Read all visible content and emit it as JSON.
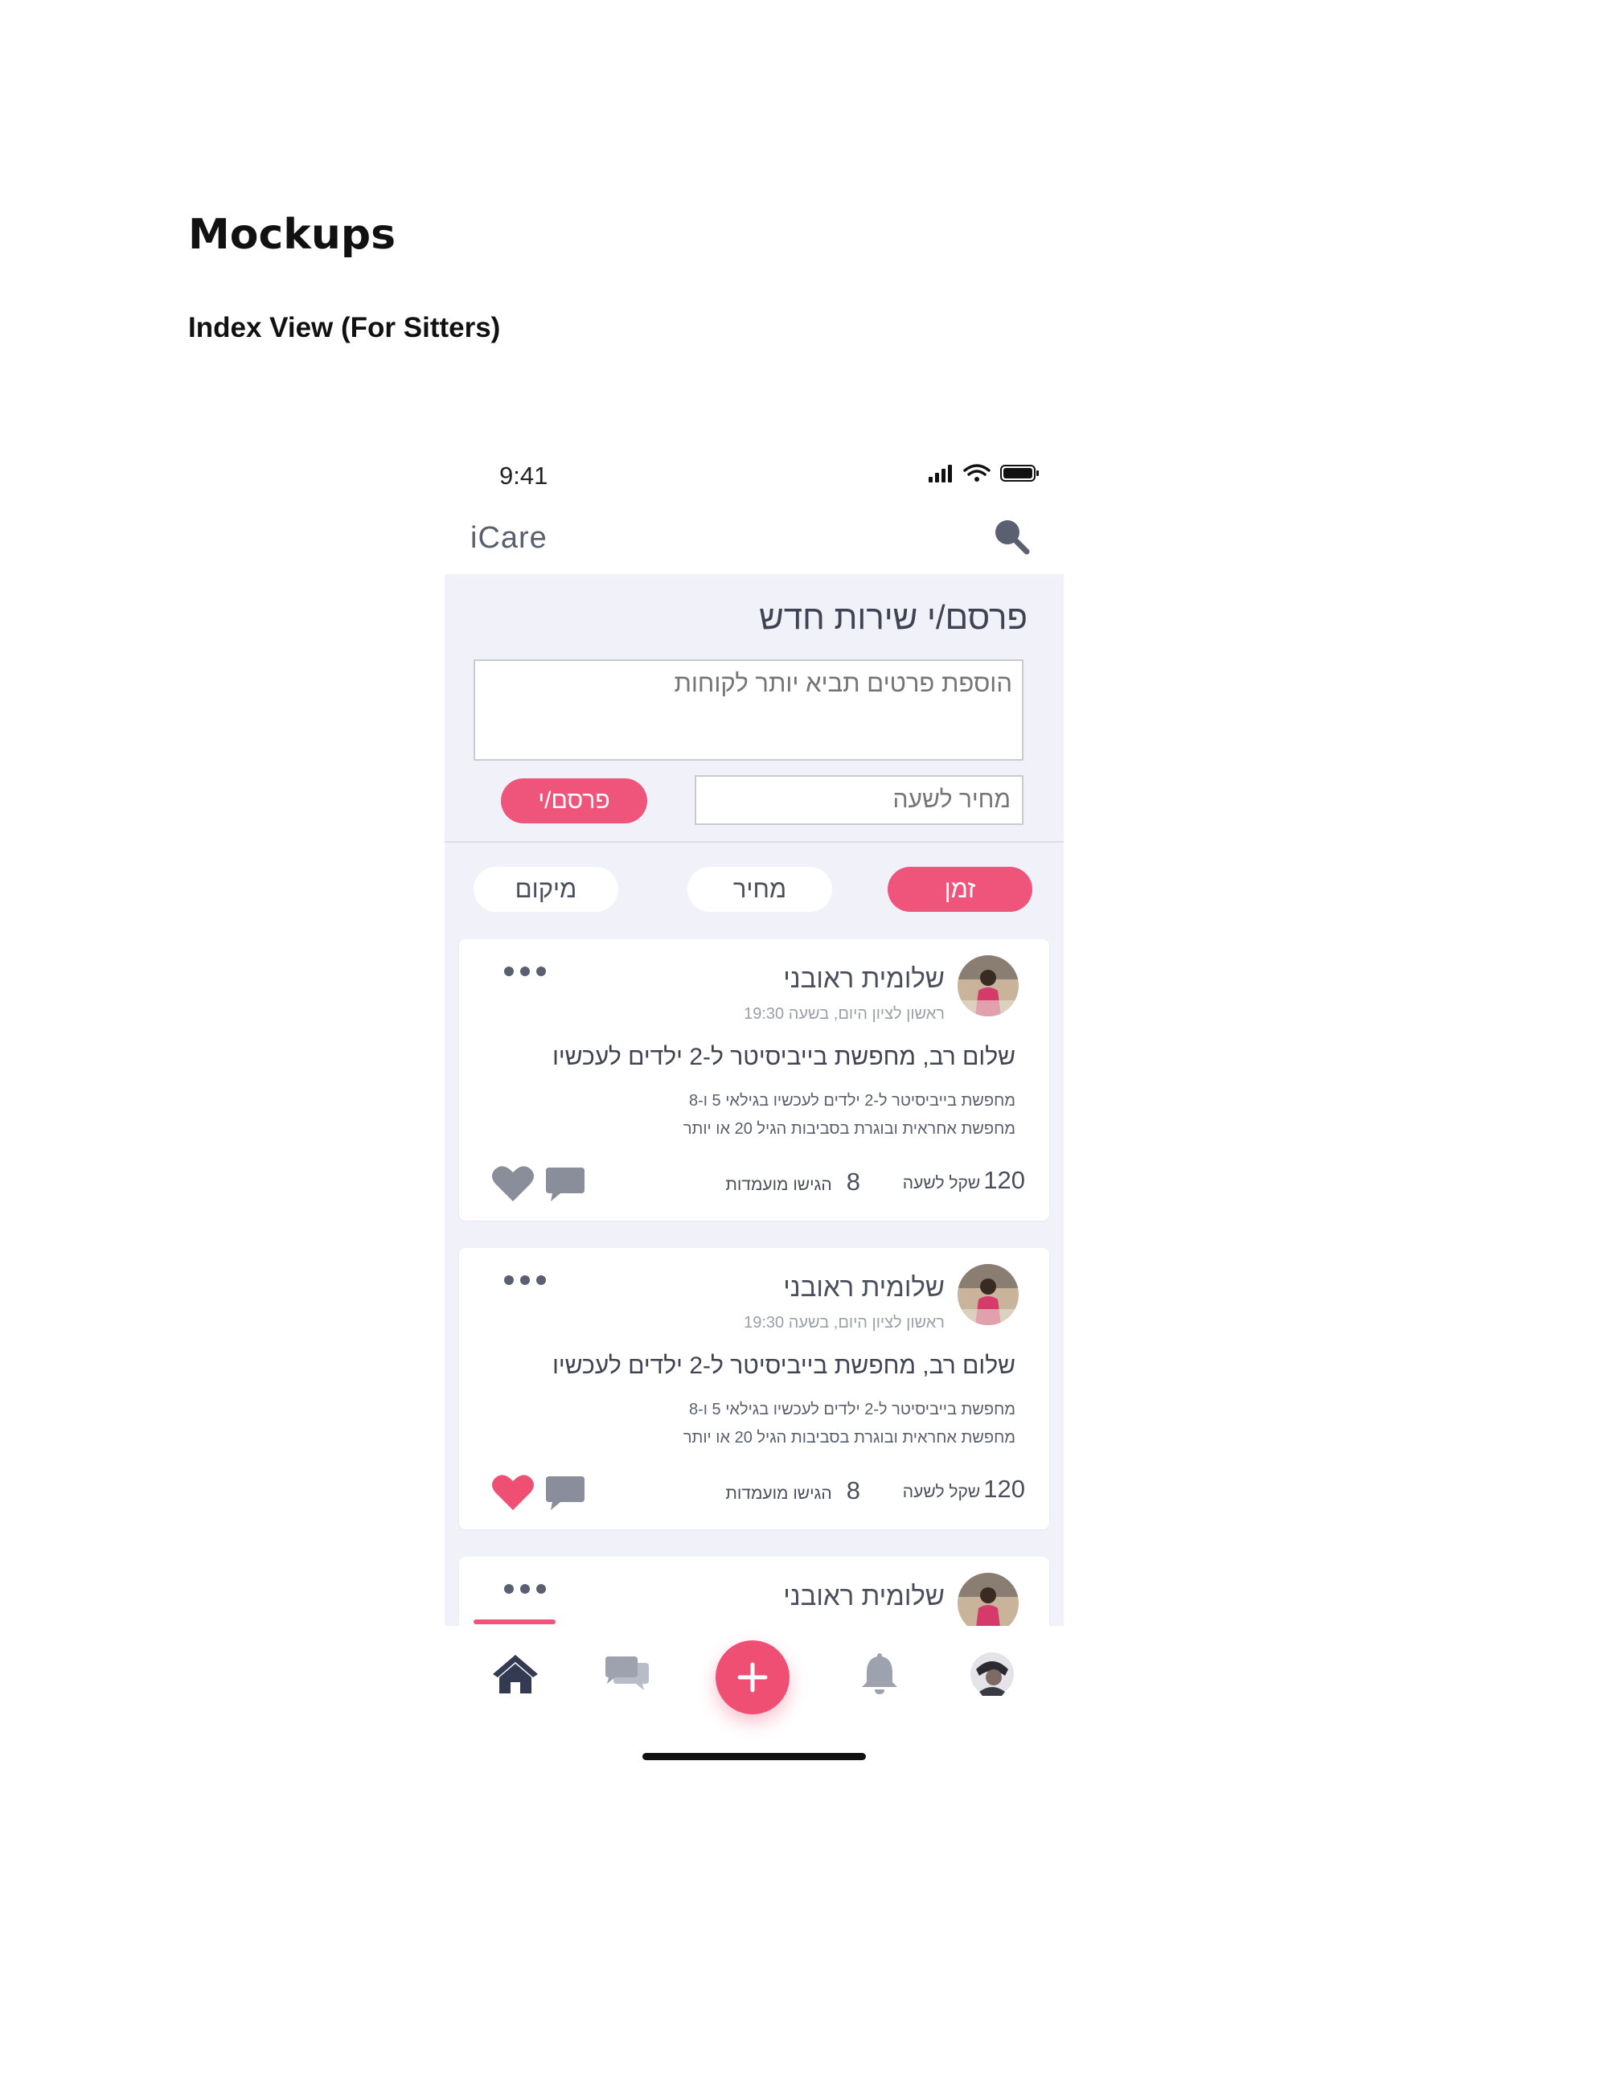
{
  "document": {
    "title": "Mockups",
    "subtitle": "Index View (For Sitters)"
  },
  "status_bar": {
    "time": "9:41"
  },
  "app": {
    "name": "iCare"
  },
  "composer": {
    "title": "פרסם/י שירות חדש",
    "details_placeholder": "הוספת פרטים תביא יותר לקוחות",
    "price_placeholder": "מחיר לשעה",
    "publish_label": "פרסם/י"
  },
  "filters": [
    {
      "label": "זמן",
      "active": true
    },
    {
      "label": "מחיר",
      "active": false
    },
    {
      "label": "מיקום",
      "active": false
    }
  ],
  "posts": [
    {
      "author": "שלומית ראובני",
      "meta": "ראשון לציון היום, בשעה 19:30",
      "headline": "שלום רב, מחפשת בייביסיטר ל-2 ילדים לעכשיו",
      "body_line1": "מחפשת בייביסיטר ל-2 ילדים לעכשיו בגילאי 5 ו-8",
      "body_line2": "מחפשת אחראית ובוגרת בסביבות הגיל 20 או יותר",
      "price": "120",
      "price_unit": "שקל לשעה",
      "offers_count": "8",
      "offers_label": "הגישו מועמדות",
      "liked": false
    },
    {
      "author": "שלומית ראובני",
      "meta": "ראשון לציון היום, בשעה 19:30",
      "headline": "שלום רב, מחפשת בייביסיטר ל-2 ילדים לעכשיו",
      "body_line1": "מחפשת בייביסיטר ל-2 ילדים לעכשיו בגילאי 5 ו-8",
      "body_line2": "מחפשת אחראית ובוגרת בסביבות הגיל 20 או יותר",
      "price": "120",
      "price_unit": "שקל לשעה",
      "offers_count": "8",
      "offers_label": "הגישו מועמדות",
      "liked": true
    },
    {
      "author": "שלומית ראובני"
    }
  ],
  "bottom_nav": [
    "home-icon",
    "chat-icon",
    "plus-icon",
    "bell-icon",
    "profile-avatar"
  ],
  "colors": {
    "accent": "#ef547a",
    "background": "#f1f2f9",
    "icon_grey": "#8a8e9a",
    "dark": "#3b3f52"
  }
}
